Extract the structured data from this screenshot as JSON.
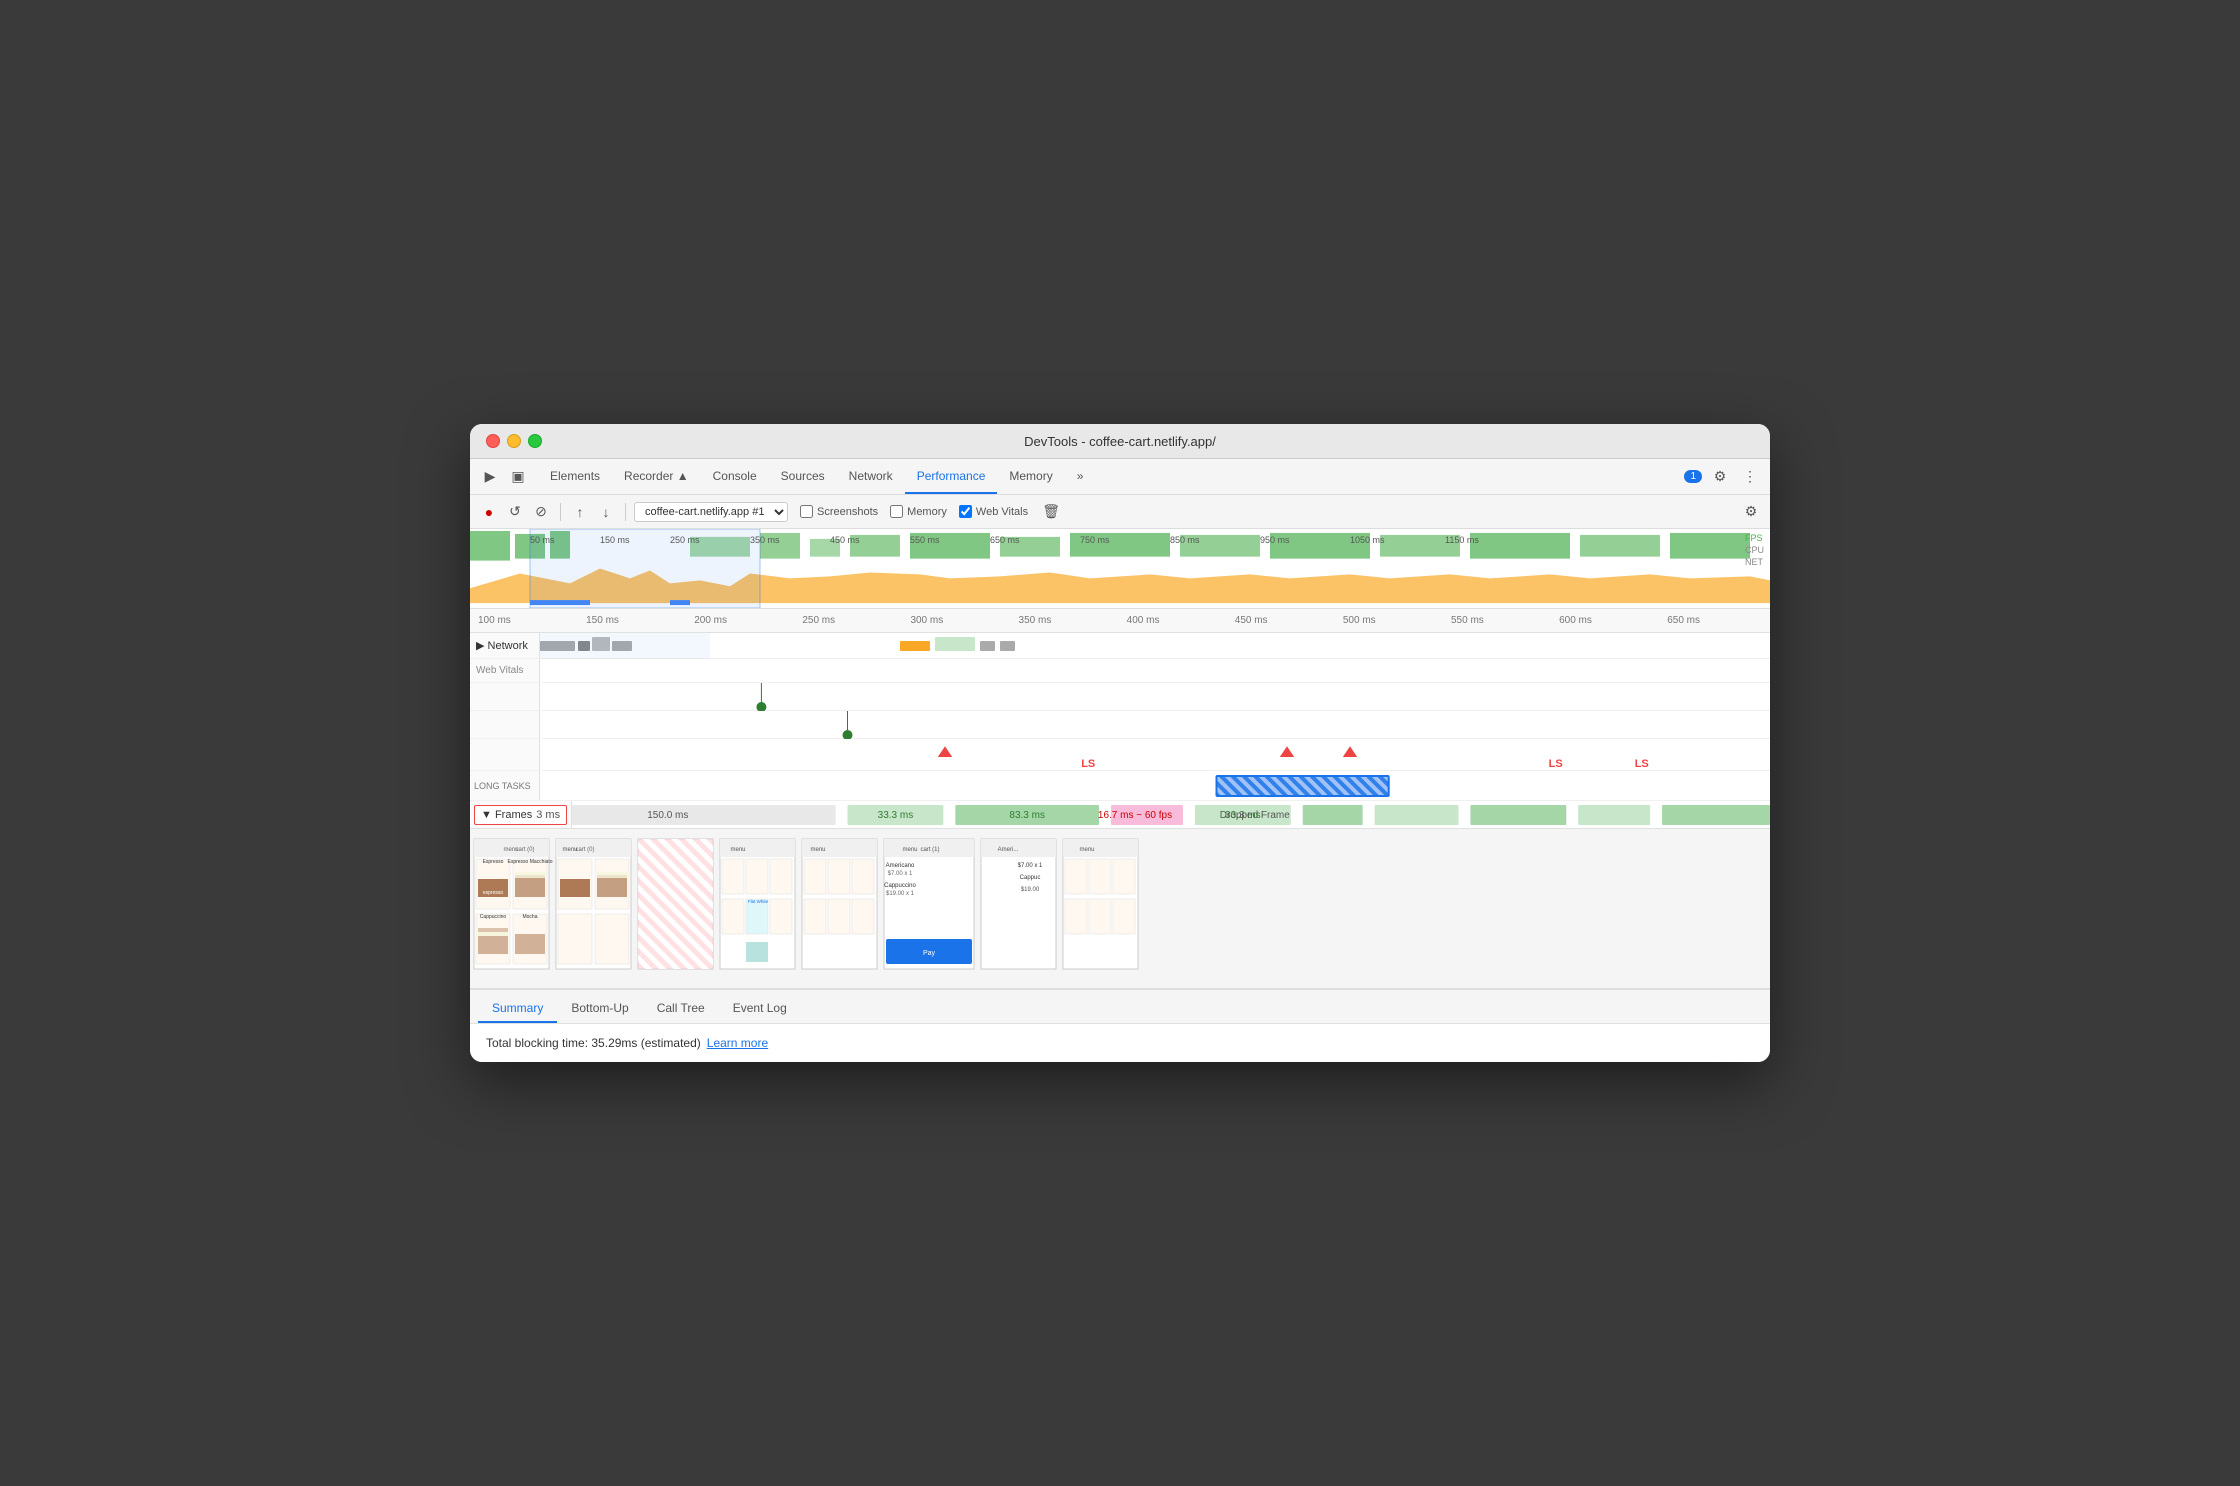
{
  "window": {
    "title": "DevTools - coffee-cart.netlify.app/"
  },
  "nav": {
    "tabs": [
      {
        "label": "Elements",
        "active": false
      },
      {
        "label": "Recorder ▲",
        "active": false
      },
      {
        "label": "Console",
        "active": false
      },
      {
        "label": "Sources",
        "active": false
      },
      {
        "label": "Network",
        "active": false
      },
      {
        "label": "Performance",
        "active": true
      },
      {
        "label": "Memory",
        "active": false
      },
      {
        "label": "»",
        "active": false
      }
    ],
    "badge": "1",
    "more_icon": "⚙",
    "dots_icon": "⋮"
  },
  "toolbar": {
    "record_label": "●",
    "reload_label": "↺",
    "clear_label": "🚫",
    "upload_label": "↑",
    "download_label": "↓",
    "target_label": "coffee-cart.netlify.app #1",
    "screenshots_label": "Screenshots",
    "memory_label": "Memory",
    "web_vitals_label": "Web Vitals",
    "trash_label": "🗑",
    "settings_label": "⚙"
  },
  "overview": {
    "fps_label": "FPS",
    "cpu_label": "CPU",
    "net_label": "NET",
    "time_markers": [
      "50 ms",
      "150 ms",
      "250 ms",
      "350 ms",
      "450 ms",
      "550 ms",
      "650 ms",
      "750 ms",
      "850 ms",
      "950 ms",
      "1050 ms",
      "1150 ms"
    ]
  },
  "timeline": {
    "ruler_marks": [
      "100 ms",
      "150 ms",
      "200 ms",
      "250 ms",
      "300 ms",
      "350 ms",
      "400 ms",
      "450 ms",
      "500 ms",
      "550 ms",
      "600 ms",
      "650 ms"
    ],
    "network_label": "▶ Network",
    "web_vitals_label": "Web Vitals",
    "long_tasks_label": "LONG TASKS"
  },
  "frames": {
    "label": "▼ Frames",
    "time_label": "3 ms",
    "segments": [
      {
        "label": "150.0 ms",
        "color": "light",
        "width_pct": 22
      },
      {
        "label": "33.3 ms",
        "color": "green",
        "width_pct": 8
      },
      {
        "label": "83.3 ms",
        "color": "green",
        "width_pct": 12
      },
      {
        "label": "",
        "color": "pink",
        "width_pct": 5
      },
      {
        "label": "33.3 ms",
        "color": "green",
        "width_pct": 8
      }
    ],
    "dropped_label": "16.7 ms ~ 60 fps",
    "dropped_suffix": "Dropped Frame"
  },
  "ls_markers": [
    {
      "label": "LS",
      "position_pct": 46
    },
    {
      "label": "LS",
      "position_pct": 84
    },
    {
      "label": "LS",
      "position_pct": 91
    }
  ],
  "screenshots": {
    "count": 8
  },
  "bottom_tabs": [
    {
      "label": "Summary",
      "active": true
    },
    {
      "label": "Bottom-Up",
      "active": false
    },
    {
      "label": "Call Tree",
      "active": false
    },
    {
      "label": "Event Log",
      "active": false
    }
  ],
  "summary": {
    "blocking_time_text": "Total blocking time: 35.29ms (estimated)",
    "learn_more_label": "Learn more"
  }
}
